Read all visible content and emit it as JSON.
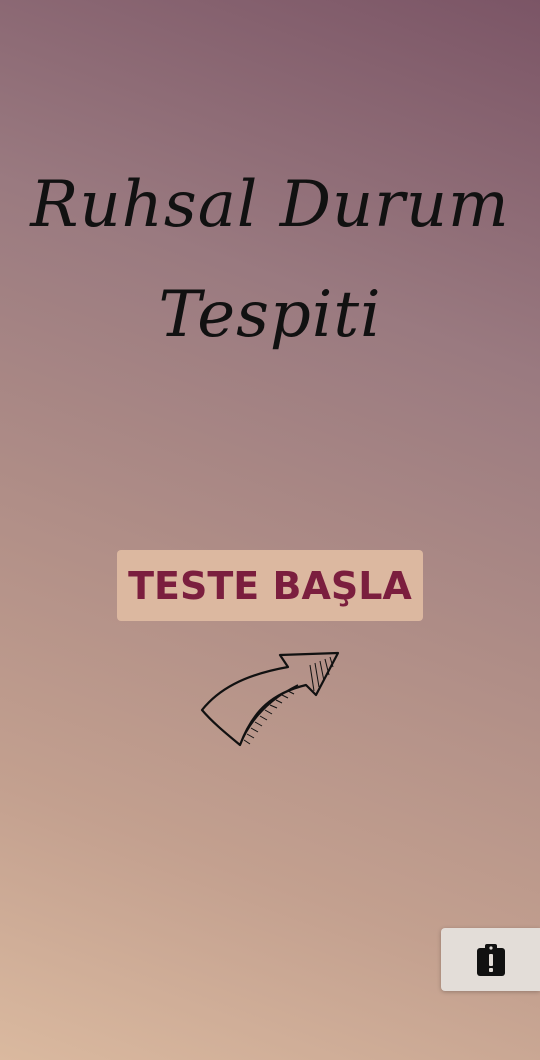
{
  "title": {
    "line1": "Ruhsal Durum",
    "line2": "Tespiti"
  },
  "start_button": {
    "label": "TESTE BAŞLA"
  },
  "arrow": {
    "icon": "hand-drawn-arrow-icon"
  },
  "fab": {
    "icon": "clipboard-alert-icon"
  },
  "colors": {
    "gradient_top": "#7b5566",
    "gradient_bottom": "#dab99f",
    "button_bg": "#dcb8a0",
    "button_text": "#7b1e3e",
    "fab_bg": "#e3ddd8"
  }
}
